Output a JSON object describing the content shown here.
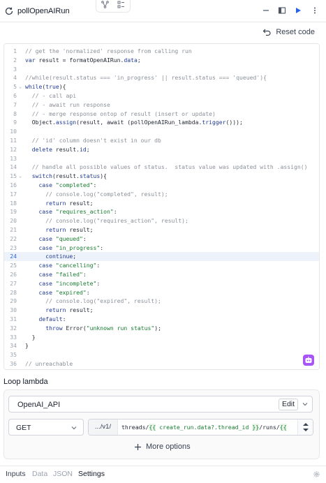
{
  "window": {
    "title": "pollOpenAIRun",
    "reset_label": "Reset code"
  },
  "editor": {
    "active_line": 24,
    "lines": [
      {
        "n": "1",
        "fold": "",
        "tokens": [
          {
            "t": "// get the 'normalized' response from calling run",
            "c": "comment"
          }
        ]
      },
      {
        "n": "2",
        "fold": "",
        "tokens": [
          {
            "t": "var",
            "c": "kw"
          },
          {
            "t": " result = formatOpenAIRun.",
            "c": "plain"
          },
          {
            "t": "data",
            "c": "prop"
          },
          {
            "t": ";",
            "c": "plain"
          }
        ]
      },
      {
        "n": "3",
        "fold": "",
        "tokens": []
      },
      {
        "n": "4",
        "fold": "",
        "tokens": [
          {
            "t": "//while(result.status === 'in_progress' || result.status === 'queued'){",
            "c": "comment"
          }
        ]
      },
      {
        "n": "5",
        "fold": "⌄",
        "tokens": [
          {
            "t": "while",
            "c": "kw"
          },
          {
            "t": "(",
            "c": "plain"
          },
          {
            "t": "true",
            "c": "kw"
          },
          {
            "t": "){",
            "c": "plain"
          }
        ]
      },
      {
        "n": "6",
        "fold": "",
        "tokens": [
          {
            "t": "  // - call api",
            "c": "comment"
          }
        ]
      },
      {
        "n": "7",
        "fold": "",
        "tokens": [
          {
            "t": "  // - await run response",
            "c": "comment"
          }
        ]
      },
      {
        "n": "8",
        "fold": "",
        "tokens": [
          {
            "t": "  // - merge response ontop of result (insert or update)",
            "c": "comment"
          }
        ]
      },
      {
        "n": "9",
        "fold": "",
        "tokens": [
          {
            "t": "  Object.",
            "c": "plain"
          },
          {
            "t": "assign",
            "c": "prop"
          },
          {
            "t": "(result, await (pollOpenAIRun_lambda.",
            "c": "plain"
          },
          {
            "t": "trigger",
            "c": "prop"
          },
          {
            "t": "()));",
            "c": "plain"
          }
        ]
      },
      {
        "n": "10",
        "fold": "",
        "tokens": []
      },
      {
        "n": "11",
        "fold": "",
        "tokens": [
          {
            "t": "  // 'id' column doesn't exist in our db",
            "c": "comment"
          }
        ]
      },
      {
        "n": "12",
        "fold": "",
        "tokens": [
          {
            "t": "  ",
            "c": "plain"
          },
          {
            "t": "delete",
            "c": "kw"
          },
          {
            "t": " result.",
            "c": "plain"
          },
          {
            "t": "id",
            "c": "prop"
          },
          {
            "t": ";",
            "c": "plain"
          }
        ]
      },
      {
        "n": "13",
        "fold": "",
        "tokens": []
      },
      {
        "n": "14",
        "fold": "",
        "tokens": [
          {
            "t": "  // handle all possible values of status.  status value was updated with .assign()",
            "c": "comment"
          }
        ]
      },
      {
        "n": "15",
        "fold": "⌄",
        "tokens": [
          {
            "t": "  ",
            "c": "plain"
          },
          {
            "t": "switch",
            "c": "kw"
          },
          {
            "t": "(result.",
            "c": "plain"
          },
          {
            "t": "status",
            "c": "prop"
          },
          {
            "t": "){",
            "c": "plain"
          }
        ]
      },
      {
        "n": "16",
        "fold": "",
        "tokens": [
          {
            "t": "    ",
            "c": "plain"
          },
          {
            "t": "case",
            "c": "kw"
          },
          {
            "t": " ",
            "c": "plain"
          },
          {
            "t": "\"completed\"",
            "c": "str"
          },
          {
            "t": ":",
            "c": "plain"
          }
        ]
      },
      {
        "n": "17",
        "fold": "",
        "tokens": [
          {
            "t": "      // console.log(\"completed\", result);",
            "c": "comment"
          }
        ]
      },
      {
        "n": "18",
        "fold": "",
        "tokens": [
          {
            "t": "      ",
            "c": "plain"
          },
          {
            "t": "return",
            "c": "kw"
          },
          {
            "t": " result;",
            "c": "plain"
          }
        ]
      },
      {
        "n": "19",
        "fold": "",
        "tokens": [
          {
            "t": "    ",
            "c": "plain"
          },
          {
            "t": "case",
            "c": "kw"
          },
          {
            "t": " ",
            "c": "plain"
          },
          {
            "t": "\"requires_action\"",
            "c": "str"
          },
          {
            "t": ":",
            "c": "plain"
          }
        ]
      },
      {
        "n": "20",
        "fold": "",
        "tokens": [
          {
            "t": "      // console.log(\"requires_action\", result);",
            "c": "comment"
          }
        ]
      },
      {
        "n": "21",
        "fold": "",
        "tokens": [
          {
            "t": "      ",
            "c": "plain"
          },
          {
            "t": "return",
            "c": "kw"
          },
          {
            "t": " result;",
            "c": "plain"
          }
        ]
      },
      {
        "n": "22",
        "fold": "",
        "tokens": [
          {
            "t": "    ",
            "c": "plain"
          },
          {
            "t": "case",
            "c": "kw"
          },
          {
            "t": " ",
            "c": "plain"
          },
          {
            "t": "\"queued\"",
            "c": "str"
          },
          {
            "t": ":",
            "c": "plain"
          }
        ]
      },
      {
        "n": "23",
        "fold": "",
        "tokens": [
          {
            "t": "    ",
            "c": "plain"
          },
          {
            "t": "case",
            "c": "kw"
          },
          {
            "t": " ",
            "c": "plain"
          },
          {
            "t": "\"in_progress\"",
            "c": "str"
          },
          {
            "t": ":",
            "c": "plain"
          }
        ]
      },
      {
        "n": "24",
        "fold": "",
        "tokens": [
          {
            "t": "      ",
            "c": "plain"
          },
          {
            "t": "continue",
            "c": "kw"
          },
          {
            "t": ";",
            "c": "plain"
          }
        ]
      },
      {
        "n": "25",
        "fold": "",
        "tokens": [
          {
            "t": "    ",
            "c": "plain"
          },
          {
            "t": "case",
            "c": "kw"
          },
          {
            "t": " ",
            "c": "plain"
          },
          {
            "t": "\"cancelling\"",
            "c": "str"
          },
          {
            "t": ":",
            "c": "plain"
          }
        ]
      },
      {
        "n": "26",
        "fold": "",
        "tokens": [
          {
            "t": "    ",
            "c": "plain"
          },
          {
            "t": "case",
            "c": "kw"
          },
          {
            "t": " ",
            "c": "plain"
          },
          {
            "t": "\"failed\"",
            "c": "str"
          },
          {
            "t": ":",
            "c": "plain"
          }
        ]
      },
      {
        "n": "27",
        "fold": "",
        "tokens": [
          {
            "t": "    ",
            "c": "plain"
          },
          {
            "t": "case",
            "c": "kw"
          },
          {
            "t": " ",
            "c": "plain"
          },
          {
            "t": "\"incomplete\"",
            "c": "str"
          },
          {
            "t": ":",
            "c": "plain"
          }
        ]
      },
      {
        "n": "28",
        "fold": "",
        "tokens": [
          {
            "t": "    ",
            "c": "plain"
          },
          {
            "t": "case",
            "c": "kw"
          },
          {
            "t": " ",
            "c": "plain"
          },
          {
            "t": "\"expired\"",
            "c": "str"
          },
          {
            "t": ":",
            "c": "plain"
          }
        ]
      },
      {
        "n": "29",
        "fold": "",
        "tokens": [
          {
            "t": "      // console.log(\"expired\", result);",
            "c": "comment"
          }
        ]
      },
      {
        "n": "30",
        "fold": "",
        "tokens": [
          {
            "t": "      ",
            "c": "plain"
          },
          {
            "t": "return",
            "c": "kw"
          },
          {
            "t": " result;",
            "c": "plain"
          }
        ]
      },
      {
        "n": "31",
        "fold": "",
        "tokens": [
          {
            "t": "    ",
            "c": "plain"
          },
          {
            "t": "default",
            "c": "kw"
          },
          {
            "t": ":",
            "c": "plain"
          }
        ]
      },
      {
        "n": "32",
        "fold": "",
        "tokens": [
          {
            "t": "      ",
            "c": "plain"
          },
          {
            "t": "throw",
            "c": "kw"
          },
          {
            "t": " Error(",
            "c": "plain"
          },
          {
            "t": "\"unknown run status\"",
            "c": "str"
          },
          {
            "t": ");",
            "c": "plain"
          }
        ]
      },
      {
        "n": "33",
        "fold": "",
        "tokens": [
          {
            "t": "  }",
            "c": "plain"
          }
        ]
      },
      {
        "n": "34",
        "fold": "",
        "tokens": [
          {
            "t": "}",
            "c": "plain"
          }
        ]
      },
      {
        "n": "35",
        "fold": "",
        "tokens": []
      },
      {
        "n": "36",
        "fold": "",
        "tokens": [
          {
            "t": "// unreachable",
            "c": "comment"
          }
        ]
      }
    ]
  },
  "loop": {
    "section_label": "Loop lambda",
    "resource_name": "OpenAI_API",
    "edit_label": "Edit",
    "method": "GET",
    "url_prefix": ".../v1/",
    "url_parts": [
      {
        "t": "threads/",
        "k": "plain"
      },
      {
        "t": "{{",
        "k": "brace"
      },
      {
        "t": " create_run.data?.thread_id ",
        "k": "tmpl"
      },
      {
        "t": "}}",
        "k": "brace"
      },
      {
        "t": "/runs/",
        "k": "plain"
      },
      {
        "t": "{{",
        "k": "brace"
      }
    ],
    "more_options_label": "More options"
  },
  "bottom_tabs": [
    "Inputs",
    "Data",
    "JSON",
    "Settings"
  ],
  "colors": {
    "accent": "#2563eb",
    "string": "#167c2e",
    "keyword": "#1f3a93",
    "comment": "#8a9099",
    "bot_button": "#a855f7"
  }
}
